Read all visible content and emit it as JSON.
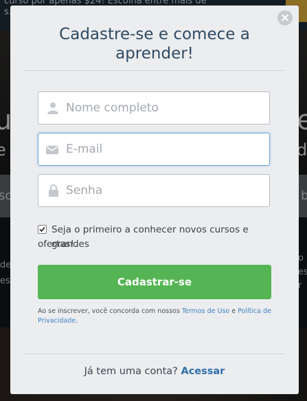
{
  "background": {
    "topbar_line1": "curso por apenas $24! Escolha entre mais de",
    "topbar_line2": "s.",
    "hero_left_big": "u",
    "hero_left_mid": "e",
    "hero_right_big": "e",
    "hero_right_mid": "de",
    "search_left": "so",
    "search_right": "b",
    "lower_left_1": "de",
    "lower_left_2": "es",
    "lower_right_1": "o",
    "lower_right_2": "es",
    "lower_right_3": "r"
  },
  "modal": {
    "close_symbol": "×",
    "title": "Cadastre-se e comece a aprender!",
    "name_placeholder": "Nome completo",
    "email_placeholder": "E-mail",
    "password_placeholder": "Senha",
    "optin_checked": true,
    "optin_text_line1": "Seja o primeiro a conhecer novos cursos e grandes",
    "optin_text_line2": "ofertas!",
    "submit_label": "Cadastrar-se",
    "terms_prefix": "Ao se inscrever, você concorda com nossos ",
    "terms_link": "Termos de Uso",
    "terms_and": " e ",
    "privacy_link": "Política de Privacidade",
    "terms_suffix": ".",
    "login_prompt": "Já tem uma conta? ",
    "login_link": "Acessar"
  },
  "colors": {
    "title": "#2f4a63",
    "button": "#55b554",
    "link": "#3c83c6",
    "focus_border": "#6aa8d8"
  }
}
